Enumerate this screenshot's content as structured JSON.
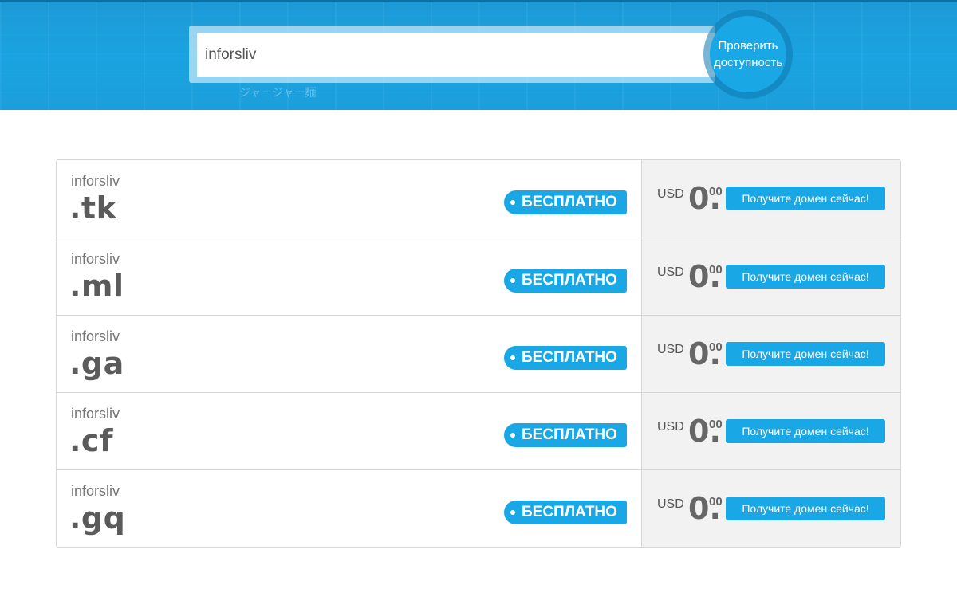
{
  "search": {
    "value": "inforsliv",
    "button_label_line1": "Проверить",
    "button_label_line2": "доступность"
  },
  "hero": {
    "background_text": "ジャージャー麺"
  },
  "colors": {
    "accent": "#1aa7e5",
    "hero_bg": "#1d9ad6"
  },
  "results": [
    {
      "name": "inforsliv",
      "tld": ".tk",
      "badge": "БЕСПЛАТНО",
      "currency": "USD",
      "price_int": "0.",
      "price_dec": "00",
      "button": "Получите домен сейчас!"
    },
    {
      "name": "inforsliv",
      "tld": ".ml",
      "badge": "БЕСПЛАТНО",
      "currency": "USD",
      "price_int": "0.",
      "price_dec": "00",
      "button": "Получите домен сейчас!"
    },
    {
      "name": "inforsliv",
      "tld": ".ga",
      "badge": "БЕСПЛАТНО",
      "currency": "USD",
      "price_int": "0.",
      "price_dec": "00",
      "button": "Получите домен сейчас!"
    },
    {
      "name": "inforsliv",
      "tld": ".cf",
      "badge": "БЕСПЛАТНО",
      "currency": "USD",
      "price_int": "0.",
      "price_dec": "00",
      "button": "Получите домен сейчас!"
    },
    {
      "name": "inforsliv",
      "tld": ".gq",
      "badge": "БЕСПЛАТНО",
      "currency": "USD",
      "price_int": "0.",
      "price_dec": "00",
      "button": "Получите домен сейчас!"
    }
  ]
}
